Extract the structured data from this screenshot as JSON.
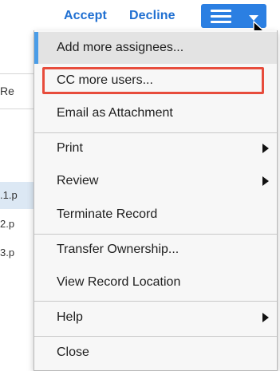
{
  "toolbar": {
    "accept_label": "Accept",
    "decline_label": "Decline",
    "menu_button_icon": "hamburger-menu-icon",
    "accent_color": "#2b7fe2"
  },
  "background": {
    "column_header": "Re",
    "rows": [
      ".1.p",
      "2.p",
      "3.p"
    ]
  },
  "menu": {
    "items": [
      {
        "label": "Add more assignees..."
      },
      {
        "label": "CC more users..."
      },
      {
        "label": "Email as Attachment"
      },
      {
        "label": "Print",
        "submenu": true
      },
      {
        "label": "Review",
        "submenu": true
      },
      {
        "label": "Terminate Record"
      },
      {
        "label": "Transfer Ownership..."
      },
      {
        "label": "View Record Location"
      },
      {
        "label": "Help",
        "submenu": true
      },
      {
        "label": "Close"
      }
    ],
    "highlight_color": "#e74c3c"
  }
}
